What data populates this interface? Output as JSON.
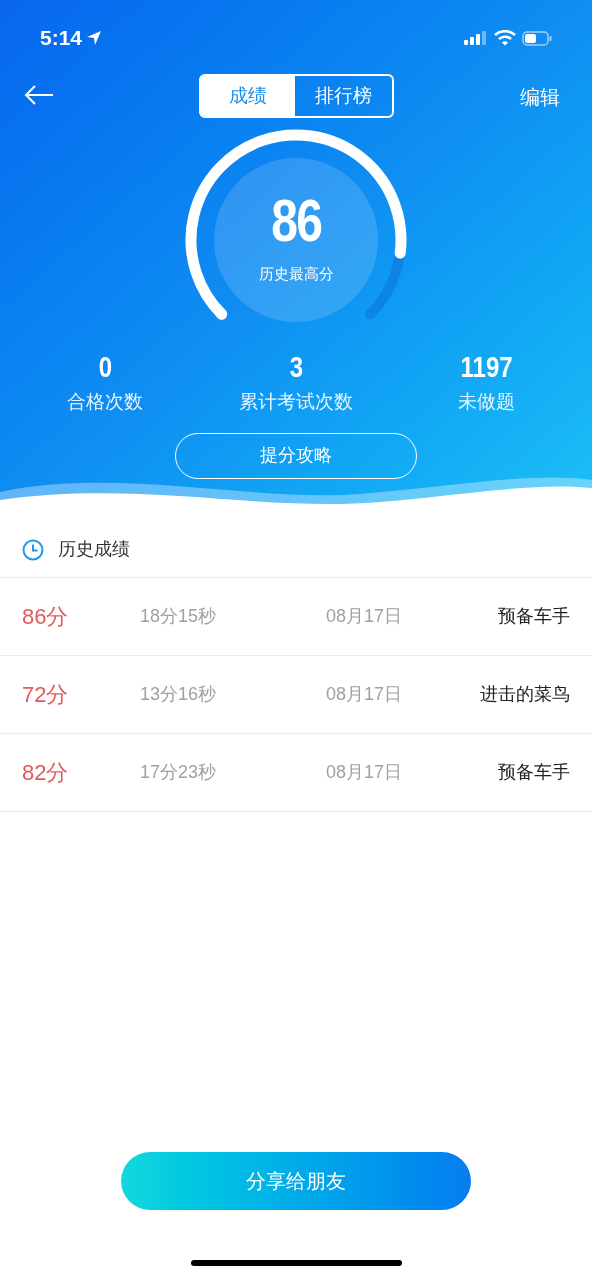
{
  "status_bar": {
    "time": "5:14"
  },
  "header": {
    "tabs": [
      {
        "label": "成绩",
        "selected": true
      },
      {
        "label": "排行榜",
        "selected": false
      }
    ],
    "edit": "编辑"
  },
  "gauge": {
    "score": "86",
    "label": "历史最高分"
  },
  "stats": [
    {
      "value": "0",
      "label": "合格次数"
    },
    {
      "value": "3",
      "label": "累计考试次数"
    },
    {
      "value": "1197",
      "label": "未做题"
    }
  ],
  "tips_button": "提分攻略",
  "history": {
    "title": "历史成绩",
    "rows": [
      {
        "score": "86分",
        "duration": "18分15秒",
        "date": "08月17日",
        "rank": "预备车手"
      },
      {
        "score": "72分",
        "duration": "13分16秒",
        "date": "08月17日",
        "rank": "进击的菜鸟"
      },
      {
        "score": "82分",
        "duration": "17分23秒",
        "date": "08月17日",
        "rank": "预备车手"
      }
    ]
  },
  "share_button": "分享给朋友"
}
